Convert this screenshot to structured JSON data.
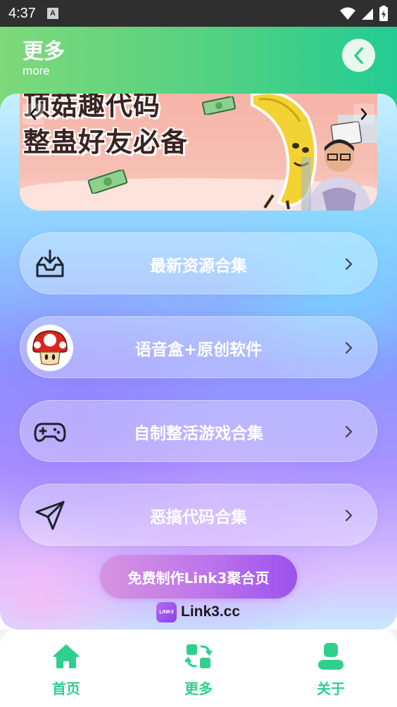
{
  "status_bar": {
    "time": "4:37",
    "notification_icon": "A"
  },
  "header": {
    "title": "更多",
    "subtitle": "more"
  },
  "banner": {
    "line1": "顶菇趣代码",
    "line2": "整蛊好友必备"
  },
  "menu": [
    {
      "label": "最新资源合集",
      "icon": "inbox-download-icon"
    },
    {
      "label": "语音盒+原创软件",
      "icon": "mushroom-icon"
    },
    {
      "label": "自制整活游戏合集",
      "icon": "gamepad-icon"
    },
    {
      "label": "恶搞代码合集",
      "icon": "paper-plane-icon"
    }
  ],
  "cta": {
    "label": "免费制作Link3聚合页"
  },
  "brand": {
    "logo_text": "LINK3",
    "name": "Link3.cc"
  },
  "bottom_nav": [
    {
      "label": "首页",
      "icon": "home-icon"
    },
    {
      "label": "更多",
      "icon": "more-apps-icon"
    },
    {
      "label": "关于",
      "icon": "user-icon"
    }
  ],
  "colors": {
    "accent": "#2fd08d",
    "header_start": "#7ed97a",
    "header_end": "#23cc94",
    "cta": "#b06cec"
  }
}
